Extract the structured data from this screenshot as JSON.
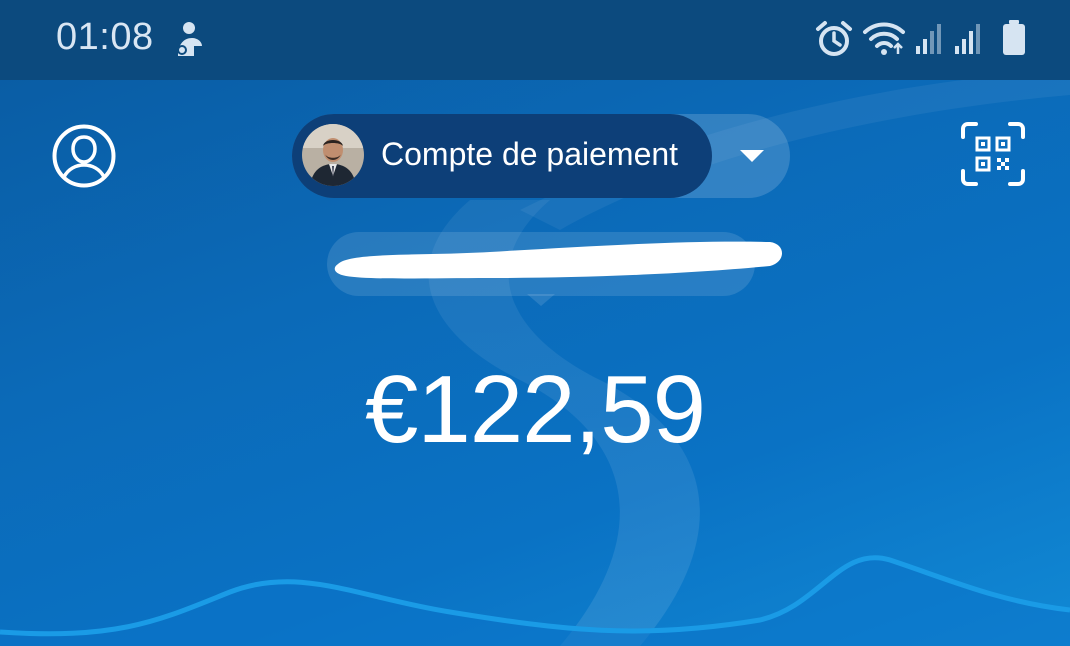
{
  "status_bar": {
    "time": "01:08",
    "icons": [
      "notification-figure-icon",
      "alarm-icon",
      "wifi-icon",
      "signal-1-icon",
      "signal-2-icon",
      "battery-icon"
    ]
  },
  "header": {
    "profile_icon": "person-outline-icon",
    "account_label": "Compte de paiement",
    "dropdown_icon": "caret-down-icon",
    "qr_icon": "qr-code-scan-icon"
  },
  "balance": {
    "amount": "€122,59"
  },
  "colors": {
    "background": "#0b6ab8",
    "status_bar": "#0c4a7e",
    "account_pill": "#0d3f78",
    "wave": "#1a9be6",
    "text": "#ffffff"
  }
}
